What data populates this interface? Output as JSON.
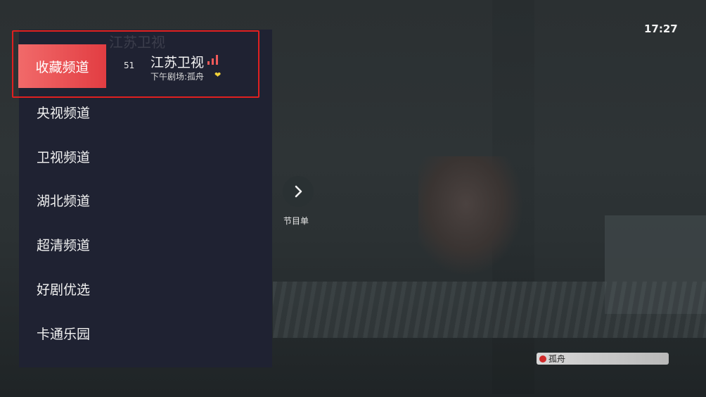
{
  "status": {
    "time": "17:27"
  },
  "sidebar": {
    "ghost_title": "江苏卫视",
    "categories": [
      {
        "label": "收藏频道",
        "selected": true
      },
      {
        "label": "央视频道"
      },
      {
        "label": "卫视频道"
      },
      {
        "label": "湖北频道"
      },
      {
        "label": "超清频道"
      },
      {
        "label": "好剧优选"
      },
      {
        "label": "卡通乐园"
      }
    ]
  },
  "channel_list": [
    {
      "number": "51",
      "name": "江苏卫视",
      "program": "下午剧场:孤舟",
      "favorite_icon": "heart-icon",
      "signal_icon": "signal-bars-icon"
    }
  ],
  "epg": {
    "label": "节目单",
    "icon": "chevron-right-icon"
  },
  "now_playing": {
    "title": "孤舟",
    "icon": "record-dot-icon"
  },
  "colors": {
    "accent": "#e84a4d",
    "focus_border": "#e02020",
    "panel_bg": "#1f2233",
    "favorite": "#f2d23a"
  }
}
